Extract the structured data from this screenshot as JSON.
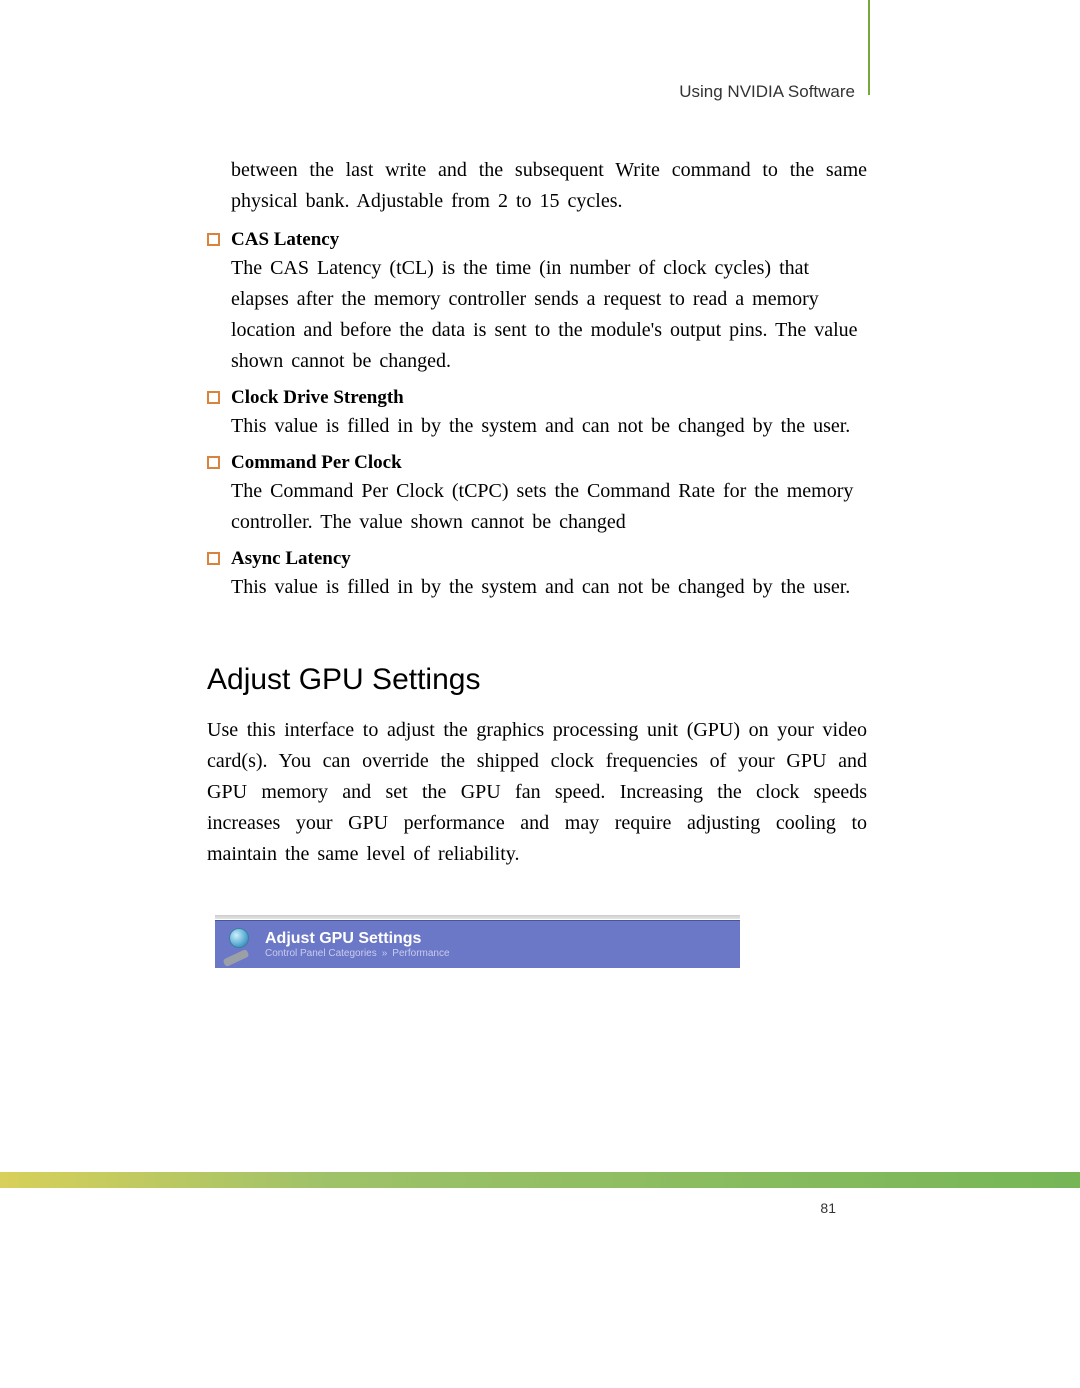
{
  "header": "Using NVIDIA Software",
  "continuation": "between the last write and the subsequent Write command to the same physical bank. Adjustable from 2 to 15 cycles.",
  "bullets": [
    {
      "title": "CAS Latency",
      "body": "The CAS Latency (tCL) is the time (in number of clock cycles) that elapses after the memory controller sends a request to read a memory location and before the data is sent to the module's output pins. The value shown cannot be changed."
    },
    {
      "title": "Clock Drive Strength",
      "body": "This value is filled in by the system and can not be changed by the user."
    },
    {
      "title": "Command Per Clock",
      "body": "The Command Per Clock (tCPC) sets the Command Rate for the memory controller. The value shown cannot be changed"
    },
    {
      "title": "Async Latency",
      "body": "This value is filled in by the system and can not be changed by the user."
    }
  ],
  "section": {
    "heading": "Adjust GPU Settings",
    "body": "Use this interface to adjust the graphics processing unit (GPU) on your video card(s). You can override the shipped clock frequencies of your GPU and GPU memory and set the GPU fan speed. Increasing the clock speeds increases your GPU performance and may require adjusting cooling to maintain the same level of reliability."
  },
  "panel": {
    "title": "Adjust GPU Settings",
    "breadcrumb_a": "Control Panel Categories",
    "breadcrumb_b": "Performance"
  },
  "page_number": "81"
}
